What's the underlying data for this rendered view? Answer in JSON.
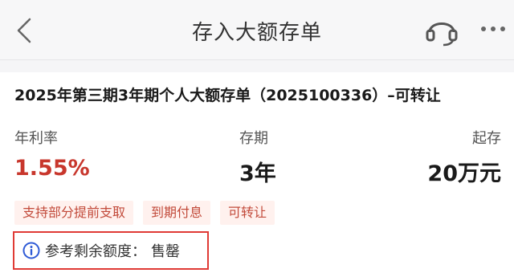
{
  "header": {
    "title": "存入大额存单",
    "icons": {
      "back": "chevron-left-icon",
      "support": "headset-icon",
      "more": "more-dots-icon"
    }
  },
  "product": {
    "name": "2025年第三期3年期个人大额存单（2025100336）–可转让",
    "rate_label": "年利率",
    "rate_value": "1.55%",
    "term_label": "存期",
    "term_value": "3年",
    "min_label": "起存",
    "min_value": "20万元",
    "tags": [
      "支持部分提前支取",
      "到期付息",
      "可转让"
    ],
    "quota_label": "参考剩余额度：",
    "quota_value": "售罄",
    "quota_icon": "info-icon"
  },
  "colors": {
    "rate": "#c8372d",
    "tag_text": "#c24a3a",
    "tag_bg": "#fff1ee",
    "highlight_border": "#e03a35",
    "info_icon": "#2f5bd6"
  }
}
